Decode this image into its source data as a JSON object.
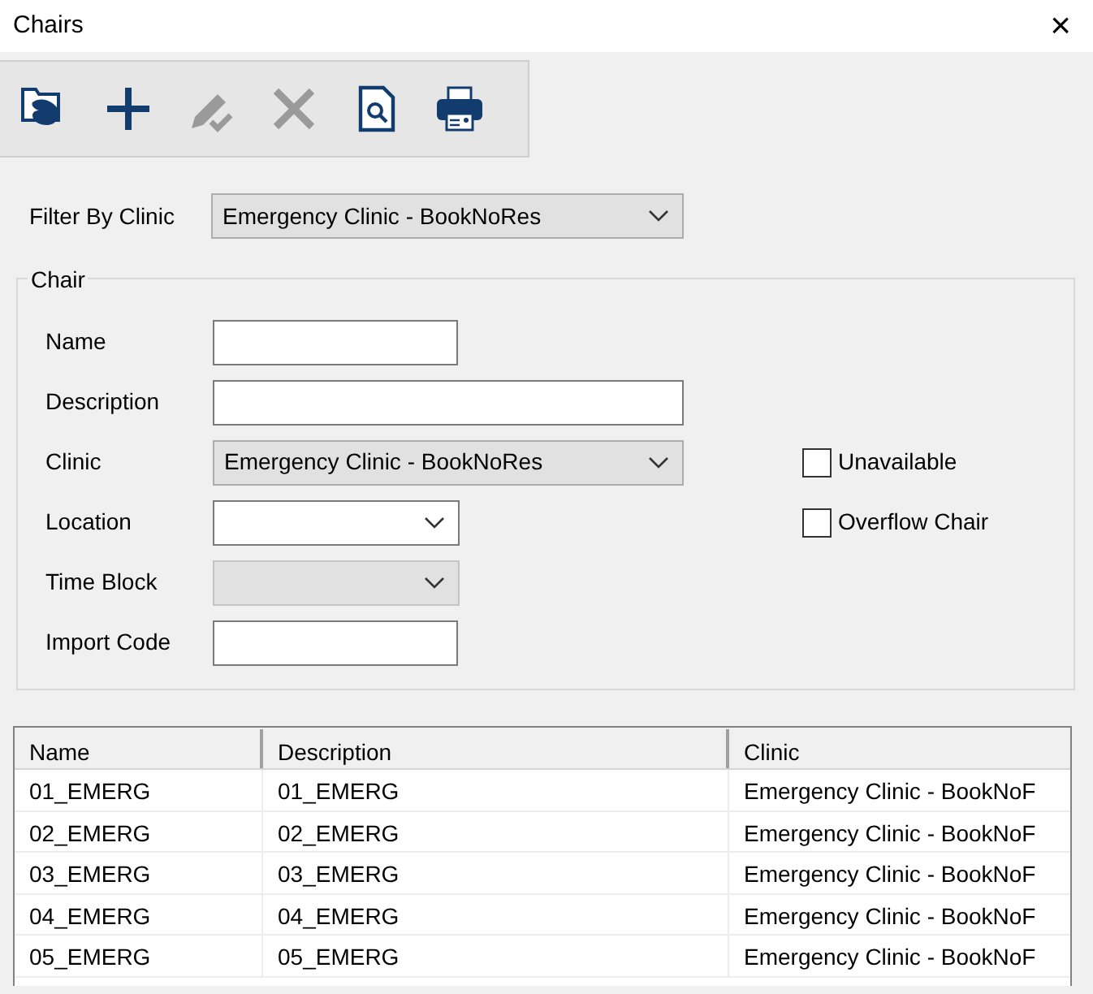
{
  "window": {
    "title": "Chairs",
    "close": "×"
  },
  "toolbar": [
    {
      "kind": "open",
      "disabled": false
    },
    {
      "kind": "add",
      "disabled": false
    },
    {
      "kind": "edit",
      "disabled": true
    },
    {
      "kind": "delete",
      "disabled": true
    },
    {
      "kind": "preview",
      "disabled": false
    },
    {
      "kind": "print",
      "disabled": false
    }
  ],
  "filter": {
    "label": "Filter By Clinic",
    "value": "Emergency Clinic - BookNoRes"
  },
  "chair": {
    "title": "Chair",
    "fields": [
      {
        "label": "Name",
        "kind": "text",
        "disabled": false
      },
      {
        "label": "Description",
        "kind": "text",
        "disabled": false
      },
      {
        "label": "Clinic",
        "kind": "dropdown",
        "disabled": false,
        "value": "Emergency Clinic - BookNoRes"
      },
      {
        "label": "Location",
        "kind": "combo",
        "disabled": false
      },
      {
        "label": "Time Block",
        "kind": "combo",
        "disabled": true
      },
      {
        "label": "Import Code",
        "kind": "text",
        "disabled": false
      }
    ],
    "checkboxes": [
      {
        "label": "Unavailable",
        "checked": false
      },
      {
        "label": "Overflow Chair",
        "checked": false
      }
    ]
  },
  "table": {
    "columns": [
      "Name",
      "Description",
      "Clinic"
    ],
    "rows": [
      [
        "01_EMERG",
        "01_EMERG",
        "Emergency Clinic - BookNoF"
      ],
      [
        "02_EMERG",
        "02_EMERG",
        "Emergency Clinic - BookNoF"
      ],
      [
        "03_EMERG",
        "03_EMERG",
        "Emergency Clinic - BookNoF"
      ],
      [
        "04_EMERG",
        "04_EMERG",
        "Emergency Clinic - BookNoF"
      ],
      [
        "05_EMERG",
        "05_EMERG",
        "Emergency Clinic - BookNoF"
      ]
    ]
  }
}
